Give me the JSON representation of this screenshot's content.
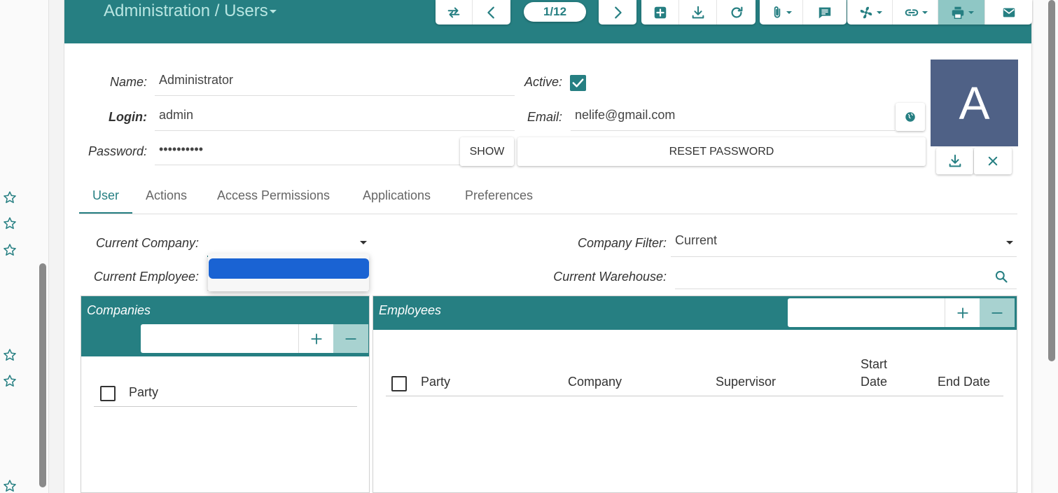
{
  "header": {
    "breadcrumb": "Administration / Users",
    "pager": "1/12"
  },
  "form": {
    "name_label": "Name:",
    "name_value": "Administrator",
    "login_label": "Login:",
    "login_value": "admin",
    "password_label": "Password:",
    "password_value": "••••••••••",
    "show_button": "SHOW",
    "active_label": "Active:",
    "active_checked": true,
    "email_label": "Email:",
    "email_value": "nelife@gmail.com",
    "reset_password_button": "RESET PASSWORD",
    "avatar_letter": "A"
  },
  "tabs": [
    {
      "label": "User",
      "active": true
    },
    {
      "label": "Actions"
    },
    {
      "label": "Access Permissions"
    },
    {
      "label": "Applications"
    },
    {
      "label": "Preferences"
    }
  ],
  "user_tab": {
    "current_company_label": "Current Company:",
    "current_company_value": "",
    "company_filter_label": "Company Filter:",
    "company_filter_value": "Current",
    "current_employee_label": "Current Employee:",
    "current_warehouse_label": "Current Warehouse:"
  },
  "companies_panel": {
    "title": "Companies",
    "columns": [
      "Party"
    ]
  },
  "employees_panel": {
    "title": "Employees",
    "columns": [
      "Party",
      "Company",
      "Supervisor",
      "Start Date",
      "End Date"
    ]
  },
  "colors": {
    "header": "#267f82",
    "accent": "#267f82",
    "avatar": "#4f6186",
    "selection": "#1a63d3"
  }
}
